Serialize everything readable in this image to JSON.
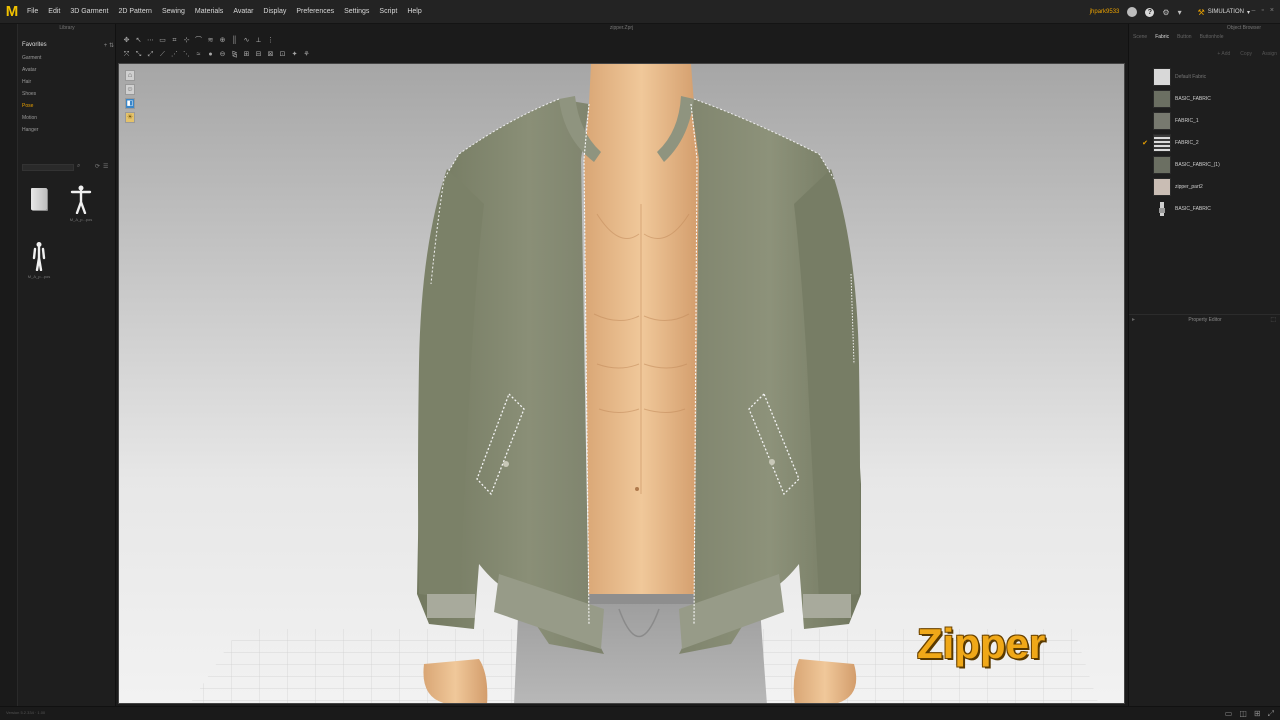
{
  "app": {
    "logo_letter": "M"
  },
  "menu": {
    "items": [
      "File",
      "Edit",
      "3D Garment",
      "2D Pattern",
      "Sewing",
      "Materials",
      "Avatar",
      "Display",
      "Preferences",
      "Settings",
      "Script",
      "Help"
    ],
    "username": "jhpark9533",
    "mode": "SIMULATION"
  },
  "library": {
    "title": "Library",
    "favorites_label": "Favorites",
    "tree": [
      "Garment",
      "Avatar",
      "Hair",
      "Shoes",
      "Pose",
      "Motion",
      "Hanger"
    ],
    "active_tree_item": "Pose",
    "thumbnails": [
      {
        "type": "folder",
        "caption": ""
      },
      {
        "type": "avatar-tpose",
        "caption": "M_A_p...pos"
      },
      {
        "type": "avatar-standing",
        "caption": "M_A_p...pos"
      }
    ]
  },
  "viewport": {
    "title": "zipper.Zprj",
    "overlay_label": "Zipper"
  },
  "object_browser": {
    "title": "Object Browser",
    "tabs": [
      "Scene",
      "Fabric",
      "Button",
      "Buttonhole"
    ],
    "active_tab": "Fabric",
    "actions": [
      "+ Add",
      "Copy",
      "Assign"
    ],
    "fabrics": [
      {
        "name": "Default Fabric",
        "swatch": "#d8d8d8",
        "dim": true,
        "checked": false,
        "kind": "plain"
      },
      {
        "name": "BASIC_FABRIC",
        "swatch": "#6b6f62",
        "dim": false,
        "checked": false,
        "kind": "plain"
      },
      {
        "name": "FABRIC_1",
        "swatch": "#77796f",
        "dim": false,
        "checked": false,
        "kind": "plain"
      },
      {
        "name": "FABRIC_2",
        "swatch": "#3a3a3a",
        "dim": false,
        "checked": true,
        "kind": "rib"
      },
      {
        "name": "BASIC_FABRIC_(1)",
        "swatch": "#6b6f62",
        "dim": false,
        "checked": false,
        "kind": "plain"
      },
      {
        "name": "zipper_part2",
        "swatch": "#c9bdb4",
        "dim": false,
        "checked": false,
        "kind": "plain"
      },
      {
        "name": "BASIC_FABRIC",
        "swatch": "#2a2a2a",
        "dim": false,
        "checked": false,
        "kind": "zipper"
      }
    ]
  },
  "property_editor": {
    "title": "Property Editor"
  },
  "status": {
    "text": "Version 5.2.334 · 1.00"
  }
}
